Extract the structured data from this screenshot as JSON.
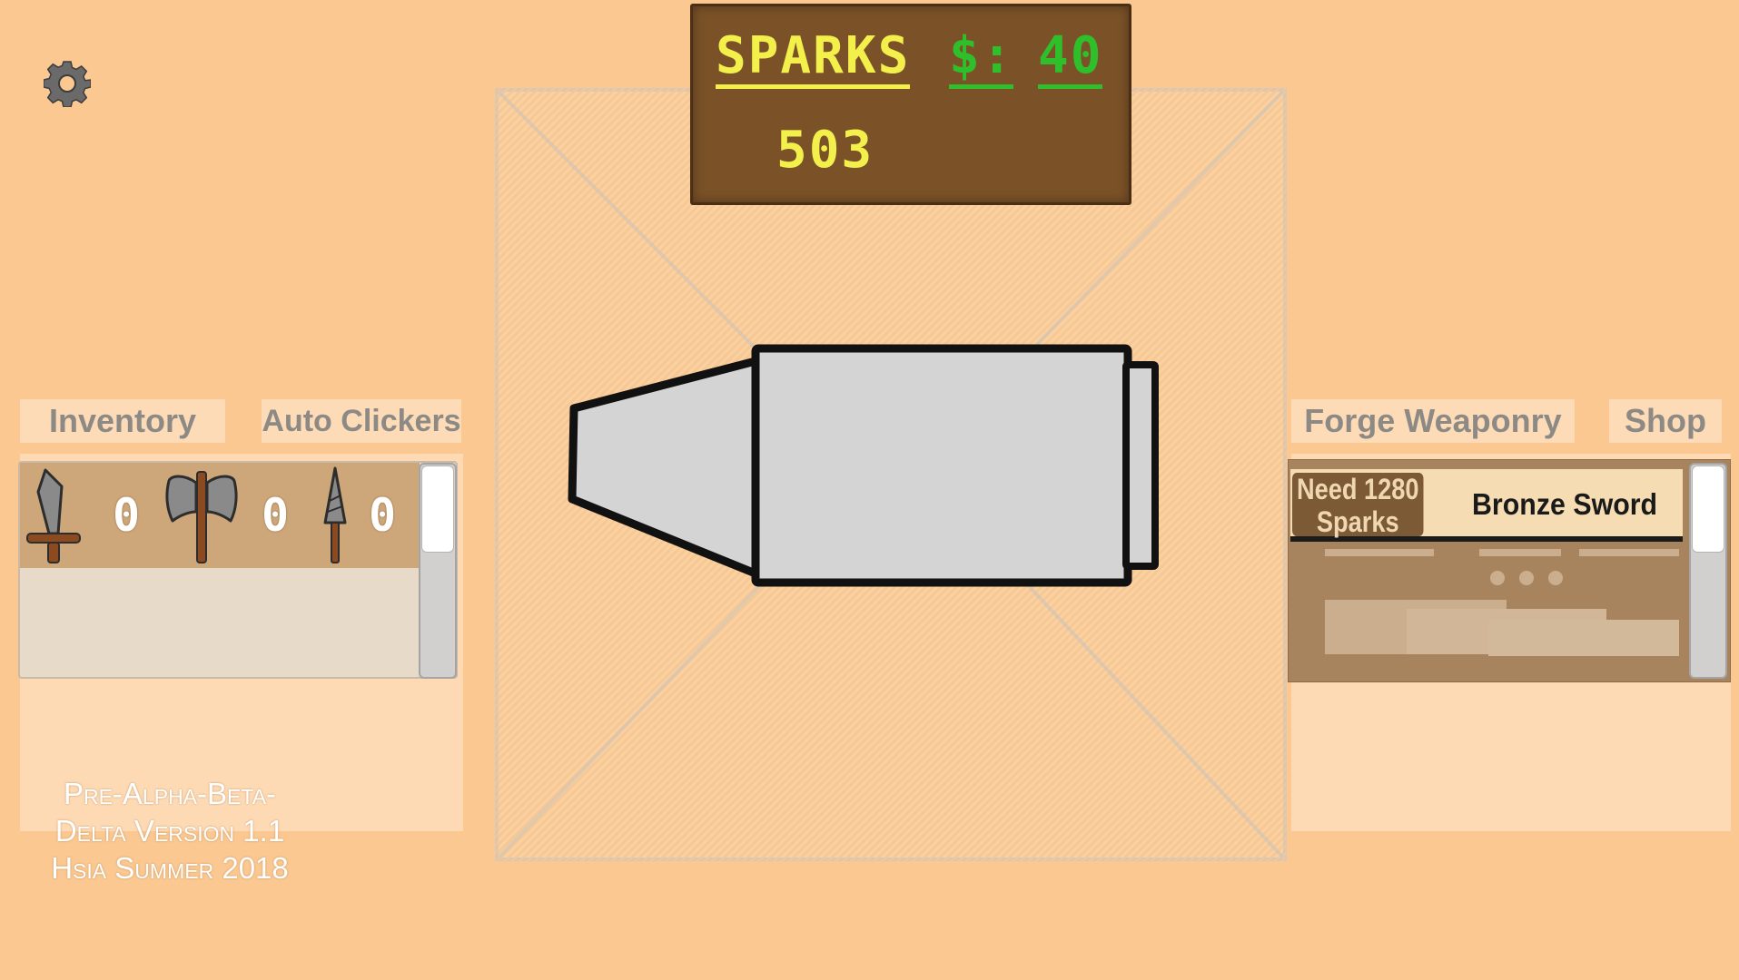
{
  "hud": {
    "sparks_label": "SPARKS",
    "sparks_value": "503",
    "money_label": "$:",
    "money_value": "40"
  },
  "left_tabs": {
    "inventory": "Inventory",
    "auto_clickers": "Auto Clickers"
  },
  "inventory": {
    "items": [
      {
        "icon": "sword-icon",
        "count": "0"
      },
      {
        "icon": "battle-axe-icon",
        "count": "0"
      },
      {
        "icon": "spear-icon",
        "count": "0"
      }
    ]
  },
  "version": {
    "line1": "Pre-Alpha-Beta-",
    "line2": "Delta Version 1.1",
    "line3": "Hsia Summer 2018"
  },
  "right_tabs": {
    "forge": "Forge Weaponry",
    "shop": "Shop"
  },
  "forge": {
    "need_line1": "Need 1280",
    "need_line2": "Sparks",
    "item_name": "Bronze Sword"
  },
  "colors": {
    "background": "#fbc891",
    "board": "#7b5228",
    "sparks_yellow": "#f3ef4b",
    "money_green": "#2fbf2a"
  }
}
